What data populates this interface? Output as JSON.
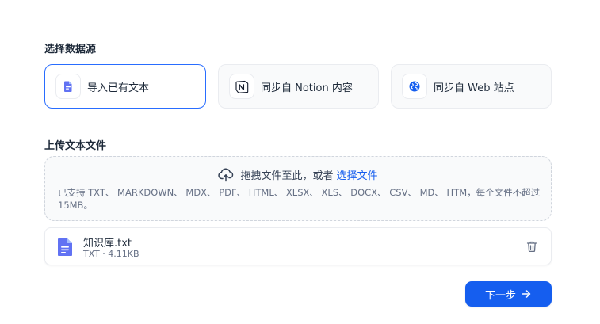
{
  "sections": {
    "source_title": "选择数据源",
    "upload_title": "上传文本文件"
  },
  "sources": [
    {
      "label": "导入已有文本",
      "icon": "file-text-icon",
      "active": true
    },
    {
      "label": "同步自 Notion 内容",
      "icon": "notion-icon",
      "active": false
    },
    {
      "label": "同步自 Web 站点",
      "icon": "web-globe-icon",
      "active": false
    }
  ],
  "dropzone": {
    "text": "拖拽文件至此，或者",
    "link": "选择文件",
    "hint": "已支持 TXT、 MARKDOWN、 MDX、 PDF、 HTML、 XLSX、 XLS、 DOCX、 CSV、 MD、 HTM，每个文件不超过 15MB。"
  },
  "file": {
    "name": "知识库.txt",
    "meta": "TXT · 4.11KB"
  },
  "next_button": "下一步",
  "colors": {
    "accent": "#155eef",
    "active_border": "#296dff",
    "file_icon": "#6172f3"
  }
}
